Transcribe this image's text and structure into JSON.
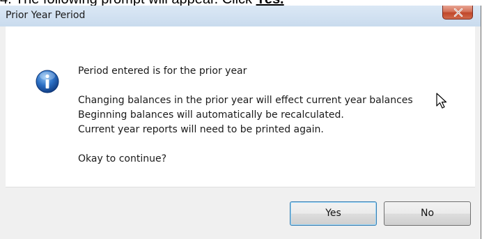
{
  "instruction": {
    "prefix": "4.   The following prompt will appear.  Click ",
    "link": "Yes."
  },
  "dialog": {
    "title": "Prior Year Period",
    "messages": {
      "line1": "Period entered is for the prior year",
      "line2": "Changing balances in the prior year will effect current year balances",
      "line3": "Beginning balances will automatically be recalculated.",
      "line4": "Current year reports will need to be printed again.",
      "line5": "Okay to continue?"
    },
    "buttons": {
      "yes": "Yes",
      "no": "No"
    },
    "icons": {
      "info": "info-icon",
      "close": "close-icon",
      "cursor": "mouse-cursor-icon"
    }
  },
  "colors": {
    "titlebar": "#c9dbee",
    "close_button": "#c1472a",
    "info_icon": "#1f5fb8",
    "content_bg": "#ffffff",
    "footer_bg": "#f0f0f0"
  }
}
